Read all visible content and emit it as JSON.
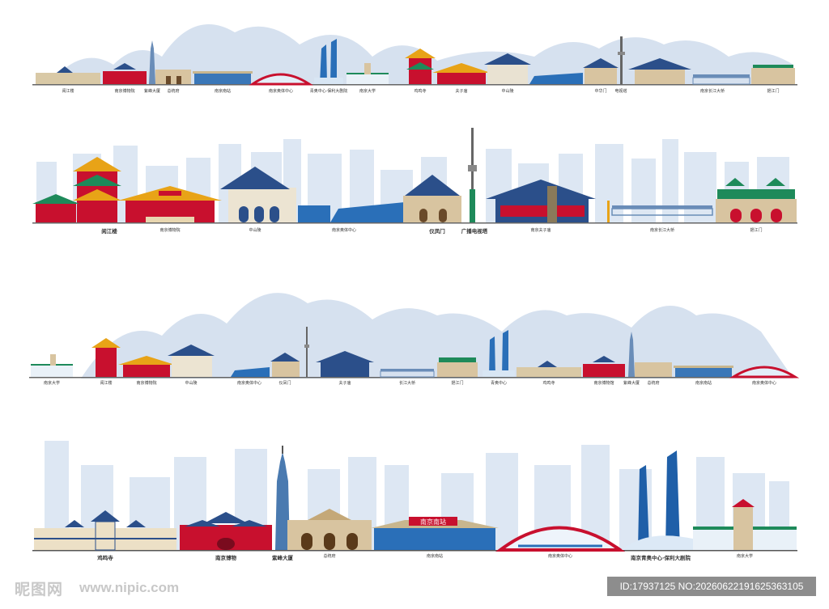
{
  "image": {
    "subject": "Nanjing landmark skyline illustrations",
    "palette": {
      "sky_mountain": "#c9d8ea",
      "ghost_building": "#dbe6f2",
      "roof_blue": "#2b4f8a",
      "wall_red": "#c8102e",
      "stone_tan": "#d8c4a0",
      "roof_green": "#1e8a5a",
      "roof_gold": "#e8a317",
      "glass_blue": "#2a6fb8",
      "ground": "#555555"
    }
  },
  "band1": {
    "labels": [
      "阅江楼",
      "南京博物院",
      "紫峰大厦",
      "总统府",
      "南京南站",
      "南京奥体中心",
      "青奥中心·保利大剧院",
      "南京大学",
      "鸡鸣寺",
      "夫子庙",
      "中山陵",
      "中华门",
      "电视塔",
      "南京长江大桥",
      "挹江门"
    ]
  },
  "band2": {
    "labels": [
      "阅江楼",
      "南京博物院",
      "中山陵",
      "南京奥体中心",
      "仪凤门",
      "广播电视塔",
      "南京夫子庙",
      "南京长江大桥",
      "挹江门"
    ]
  },
  "band3": {
    "labels": [
      "南京大学",
      "阅江楼",
      "南京博物院",
      "中山陵",
      "南京奥体中心",
      "仪凤门",
      "夫子庙",
      "长江大桥",
      "挹江门",
      "青奥中心",
      "鸡鸣寺",
      "南京博物馆",
      "紫峰大厦",
      "总统府",
      "南京南站",
      "南京奥体中心"
    ]
  },
  "band4": {
    "labels": [
      "鸡鸣寺",
      "南京博物",
      "紫峰大厦",
      "总统府",
      "南京南站",
      "南京奥体中心",
      "南京青奥中心·保利大剧院",
      "南京大学"
    ],
    "station_sign": "南京南站"
  },
  "footer": {
    "logo": "昵图网",
    "url": "www.nipic.com",
    "id_text": "ID:17937125 NO:20260622191625363105"
  }
}
